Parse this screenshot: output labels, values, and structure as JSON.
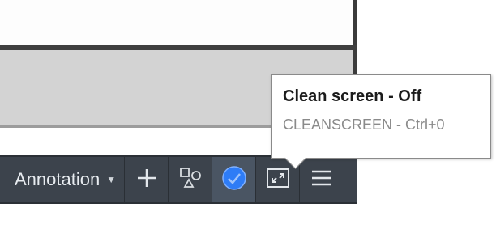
{
  "status_bar": {
    "annotation_label": "Annotation",
    "buttons": [
      {
        "name": "plus-icon"
      },
      {
        "name": "isolate-objects-icon"
      },
      {
        "name": "hardware-acceleration-icon",
        "color": "#2e7cf6"
      },
      {
        "name": "clean-screen-icon"
      },
      {
        "name": "hamburger-menu-icon"
      }
    ]
  },
  "tooltip": {
    "title": "Clean screen - Off",
    "subtitle": "CLEANSCREEN - Ctrl+0"
  },
  "colors": {
    "status_bar_bg": "#3c434c",
    "panel_grey": "#d3d3d3",
    "accent_blue": "#2e7cf6"
  }
}
